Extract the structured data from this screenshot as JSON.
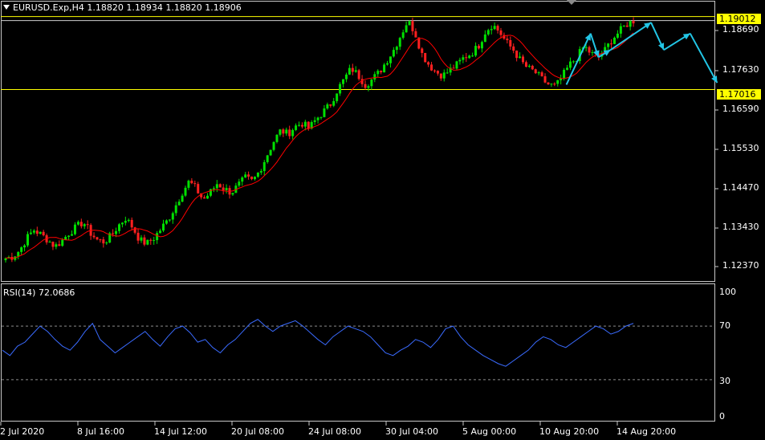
{
  "window": {
    "symbol_header": "EURUSD.Exp,H4  1.18820 1.18934 1.18820 1.18906",
    "indicator_header": "RSI(14) 72.0686"
  },
  "colors": {
    "background": "#000000",
    "bull_candle": "#00e000",
    "bear_candle": "#ff2020",
    "moving_average": "#ff0000",
    "rsi_line": "#3a6bff",
    "level_line": "#ffff00",
    "forecast_arrows": "#22c6e6",
    "price_tag_bg": "#ffff00"
  },
  "price_tags": [
    "1.19012",
    "1.17016"
  ],
  "chart_data": [
    {
      "type": "candlestick",
      "panel": "price",
      "y_ticks": [
        "1.18690",
        "1.17630",
        "1.16590",
        "1.15530",
        "1.14470",
        "1.13430",
        "1.12370"
      ],
      "ylim": [
        1.118,
        1.194
      ],
      "x_ticks": [
        "2 Jul 2020",
        "8 Jul 16:00",
        "14 Jul 12:00",
        "20 Jul 08:00",
        "24 Jul 08:00",
        "30 Jul 04:00",
        "5 Aug 00:00",
        "10 Aug 20:00",
        "14 Aug 20:00"
      ],
      "last_quote": {
        "open": 1.1882,
        "high": 1.18934,
        "low": 1.1882,
        "close": 1.18906
      },
      "horizontal_levels": [
        1.19012,
        1.17016
      ],
      "close_path": [
        1.124,
        1.1245,
        1.1262,
        1.1295,
        1.1318,
        1.1305,
        1.129,
        1.1272,
        1.1288,
        1.131,
        1.1325,
        1.134,
        1.131,
        1.129,
        1.1285,
        1.1302,
        1.133,
        1.135,
        1.1325,
        1.129,
        1.128,
        1.1295,
        1.132,
        1.1345,
        1.138,
        1.142,
        1.145,
        1.143,
        1.14,
        1.142,
        1.1445,
        1.143,
        1.142,
        1.144,
        1.146,
        1.145,
        1.148,
        1.152,
        1.156,
        1.159,
        1.158,
        1.16,
        1.161,
        1.1595,
        1.162,
        1.164,
        1.166,
        1.17,
        1.173,
        1.176,
        1.174,
        1.1715,
        1.173,
        1.175,
        1.178,
        1.181,
        1.185,
        1.189,
        1.186,
        1.18,
        1.177,
        1.175,
        1.174,
        1.1755,
        1.177,
        1.179,
        1.18,
        1.182,
        1.186,
        1.188,
        1.186,
        1.183,
        1.181,
        1.178,
        1.176,
        1.175,
        1.173,
        1.1715,
        1.171,
        1.174,
        1.177,
        1.179,
        1.182,
        1.18,
        1.179,
        1.181,
        1.184,
        1.186,
        1.188,
        1.189
      ],
      "forecast_zigzag": [
        {
          "t": 0.793,
          "p": 1.1715
        },
        {
          "t": 0.827,
          "p": 1.1855
        },
        {
          "t": 0.838,
          "p": 1.179
        },
        {
          "t": 0.855,
          "p": 1.181
        },
        {
          "t": 0.912,
          "p": 1.1885
        },
        {
          "t": 0.93,
          "p": 1.181
        },
        {
          "t": 0.967,
          "p": 1.1855
        },
        {
          "t": 1.005,
          "p": 1.172
        }
      ]
    },
    {
      "type": "line",
      "panel": "indicator",
      "name": "RSI(14)",
      "y_ticks": [
        "100",
        "70",
        "30",
        "0"
      ],
      "levels": [
        70,
        30
      ],
      "ylim": [
        0,
        100
      ],
      "values": [
        52,
        48,
        55,
        58,
        64,
        70,
        66,
        60,
        55,
        52,
        58,
        66,
        72,
        60,
        55,
        50,
        54,
        58,
        62,
        66,
        60,
        55,
        62,
        68,
        70,
        65,
        58,
        60,
        54,
        50,
        56,
        60,
        66,
        72,
        75,
        70,
        66,
        70,
        72,
        74,
        70,
        65,
        60,
        56,
        62,
        66,
        70,
        68,
        66,
        62,
        56,
        50,
        48,
        52,
        55,
        60,
        58,
        54,
        60,
        68,
        70,
        62,
        56,
        52,
        48,
        45,
        42,
        40,
        44,
        48,
        52,
        58,
        62,
        60,
        56,
        54,
        58,
        62,
        66,
        70,
        68,
        64,
        66,
        70,
        72
      ]
    }
  ]
}
